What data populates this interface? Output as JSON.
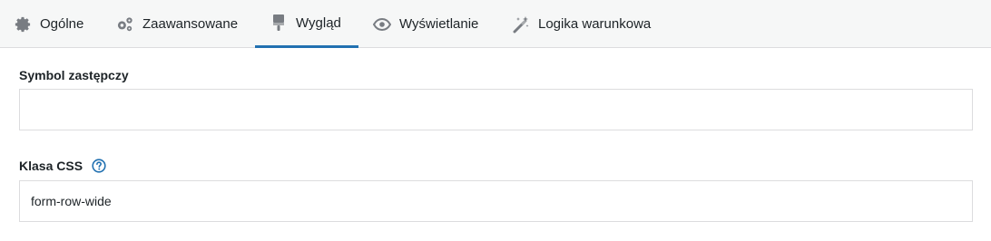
{
  "tabs": [
    {
      "label": "Ogólne",
      "icon": "gear-icon",
      "active": false
    },
    {
      "label": "Zaawansowane",
      "icon": "gears-icon",
      "active": false
    },
    {
      "label": "Wygląd",
      "icon": "paintbrush-icon",
      "active": true
    },
    {
      "label": "Wyświetlanie",
      "icon": "eye-icon",
      "active": false
    },
    {
      "label": "Logika warunkowa",
      "icon": "magic-wand-icon",
      "active": false
    }
  ],
  "fields": {
    "placeholder": {
      "label": "Symbol zastępczy",
      "value": ""
    },
    "css_class": {
      "label": "Klasa CSS",
      "value": "form-row-wide",
      "help_icon": "question-circle-icon"
    }
  },
  "colors": {
    "accent": "#2271b1",
    "icon_gray": "#787c82",
    "tab_bar_bg": "#f6f7f7"
  }
}
